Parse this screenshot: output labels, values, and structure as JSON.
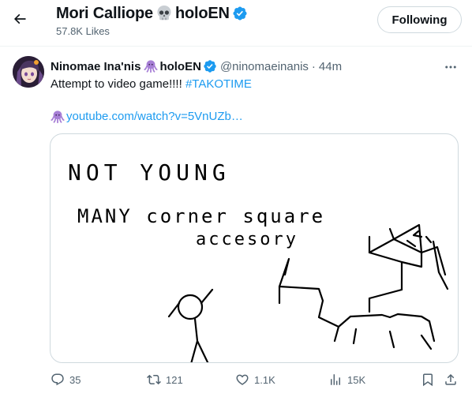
{
  "header": {
    "title_name": "Mori Calliope",
    "title_suffix": "holoEN",
    "subtitle": "57.8K Likes",
    "follow_label": "Following"
  },
  "tweet": {
    "author_name": "Ninomae Ina'nis",
    "author_suffix": "holoEN",
    "handle": "@ninomaeinanis",
    "dot": "·",
    "time": "44m",
    "text": "Attempt to video game!!!!",
    "hashtag": "#TAKOTIME",
    "link": "youtube.com/watch?v=5VnUZb…"
  },
  "media": {
    "drawing_line1": "NOT YOUNG",
    "drawing_line2": "MANY corner square",
    "drawing_line3": "accesory"
  },
  "actions": {
    "replies": "35",
    "reposts": "121",
    "likes": "1.1K",
    "views": "15K"
  },
  "colors": {
    "accent": "#1d9bf0",
    "verified": "#1d9bf0",
    "muted": "#536471",
    "octopus": "#a77fd6"
  }
}
